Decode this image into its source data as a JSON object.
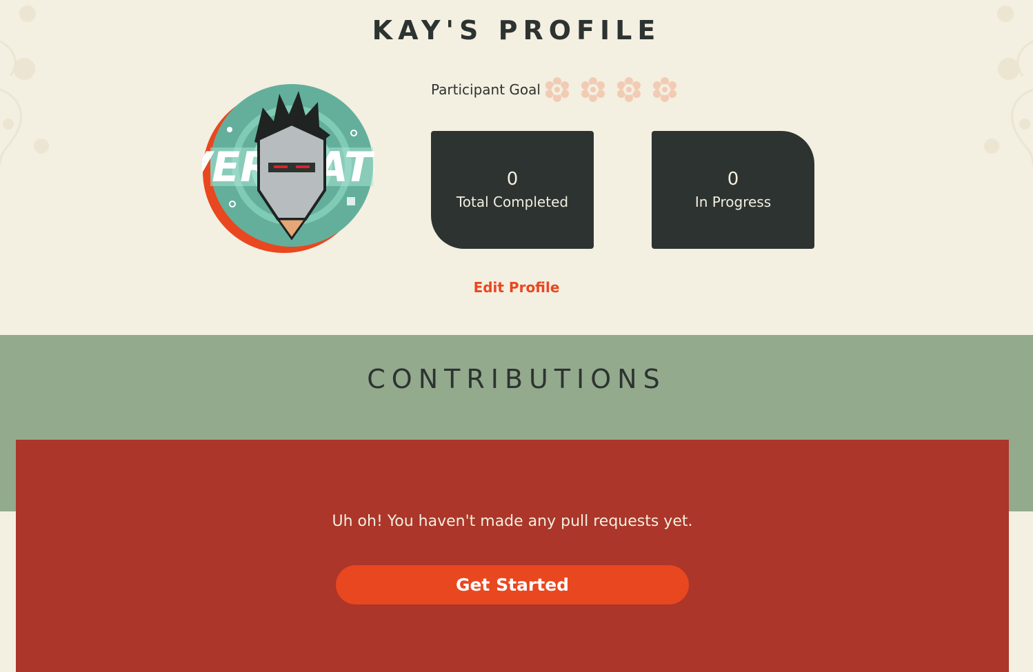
{
  "page": {
    "title": "KAY'S PROFILE"
  },
  "profile": {
    "avatar": {
      "icon": "avatar-overwatch-ninja",
      "lettering": "OVERWATCH"
    },
    "goal": {
      "label": "Participant Goal",
      "badges_total": 4,
      "badges_earned": 0,
      "badge_icon": "flower-badge-icon"
    },
    "stats": [
      {
        "value": "0",
        "label": "Total Completed"
      },
      {
        "value": "0",
        "label": "In Progress"
      }
    ],
    "edit_label": "Edit Profile"
  },
  "contributions": {
    "title": "CONTRIBUTIONS",
    "empty_message": "Uh oh! You haven't made any pull requests yet.",
    "cta_label": "Get Started"
  },
  "colors": {
    "background": "#f3efe1",
    "dark": "#2d3331",
    "accent": "#e9471f",
    "sage": "#93aa8d",
    "panel_red": "#ab3629",
    "badge_inactive": "#f2c8b0"
  }
}
